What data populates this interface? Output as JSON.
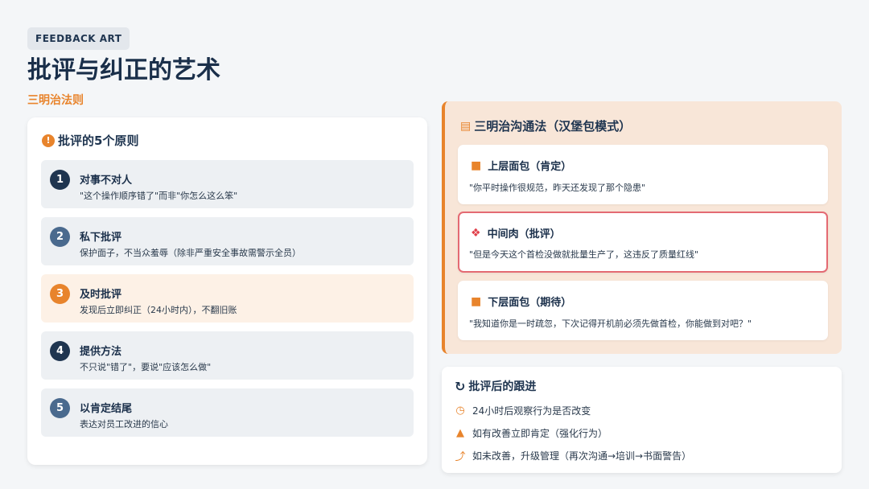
{
  "header": {
    "tag": "FEEDBACK ART",
    "title": "批评与纠正的艺术",
    "subtitle": "三明治法则"
  },
  "principles_card": {
    "title": "批评的5个原则",
    "items": [
      {
        "num": "1",
        "title": "对事不对人",
        "desc": "\"这个操作顺序错了\"而非\"你怎么这么笨\"",
        "color": "#1f3550"
      },
      {
        "num": "2",
        "title": "私下批评",
        "desc": "保护面子，不当众羞辱（除非严重安全事故需警示全员）",
        "color": "#4a6a8e"
      },
      {
        "num": "3",
        "title": "及时批评",
        "desc": "发现后立即纠正（24小时内），不翻旧账",
        "color": "#e8842c"
      },
      {
        "num": "4",
        "title": "提供方法",
        "desc": "不只说\"错了\"，要说\"应该怎么做\"",
        "color": "#1f3550"
      },
      {
        "num": "5",
        "title": "以肯定结尾",
        "desc": "表达对员工改进的信心",
        "color": "#4a6a8e"
      }
    ]
  },
  "sandwich_card": {
    "title": "三明治沟通法（汉堡包模式）",
    "layers": [
      {
        "title": "上层面包（肯定）",
        "text": "\"你平时操作很规范，昨天还发现了那个隐患\""
      },
      {
        "title": "中间肉（批评）",
        "text": "\"但是今天这个首检没做就批量生产了，这违反了质量红线\""
      },
      {
        "title": "下层面包（期待）",
        "text": "\"我知道你是一时疏忽，下次记得开机前必须先做首检，你能做到对吧？\""
      }
    ]
  },
  "follow_card": {
    "title": "批评后的跟进",
    "items": [
      {
        "icon": "clock-icon",
        "text": "24小时后观察行为是否改变"
      },
      {
        "icon": "thumbs-up-icon",
        "text": "如有改善立即肯定（强化行为）"
      },
      {
        "icon": "escalate-arrow-icon",
        "text": "如未改善，升级管理（再次沟通→培训→书面警告）"
      }
    ]
  },
  "colors": {
    "accent": "#e8842c",
    "navy": "#1f3550",
    "critic_border": "#e46a73"
  }
}
